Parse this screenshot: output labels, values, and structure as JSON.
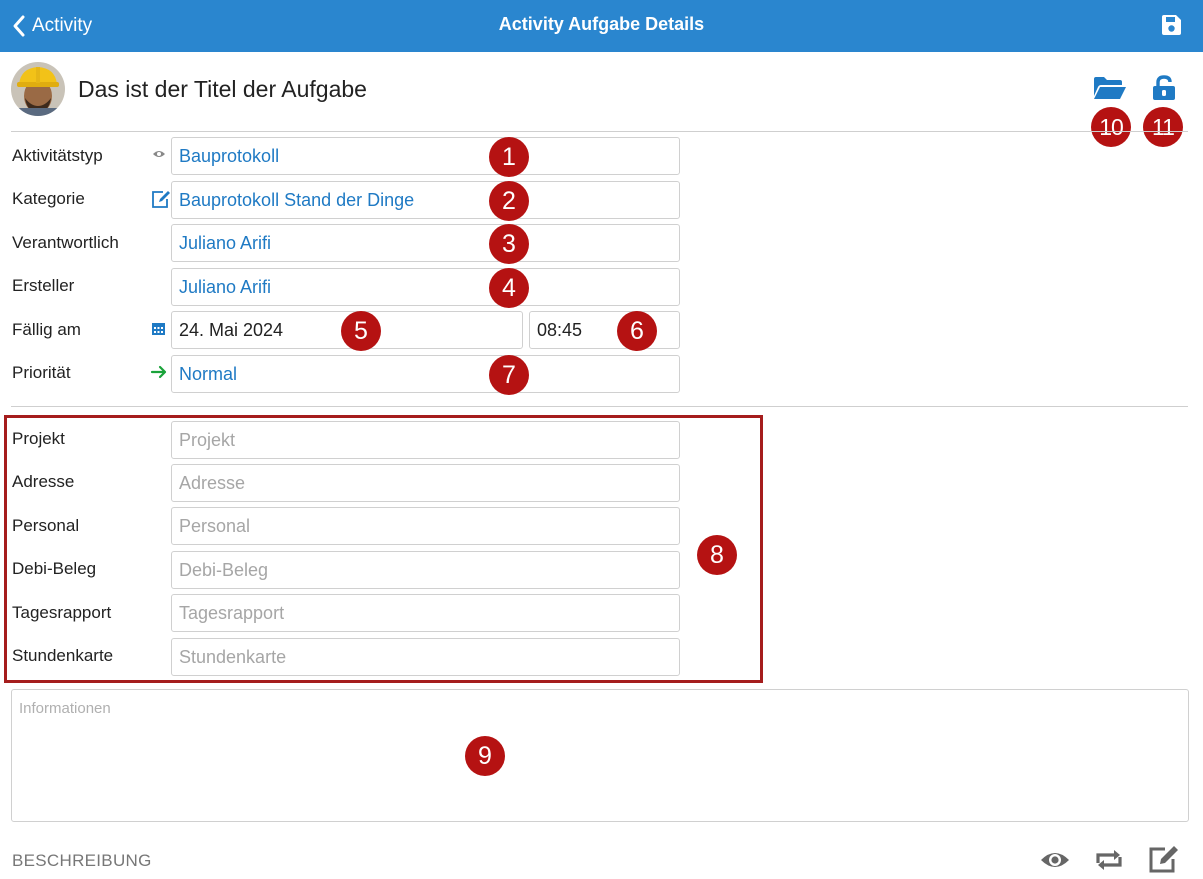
{
  "nav": {
    "back_label": "Activity",
    "title": "Activity Aufgabe Details"
  },
  "header": {
    "task_title": "Das ist der Titel der Aufgabe"
  },
  "form": {
    "aktivitaetstyp": {
      "label": "Aktivitätstyp",
      "value": "Bauprotokoll"
    },
    "kategorie": {
      "label": "Kategorie",
      "value": "Bauprotokoll Stand der Dinge"
    },
    "verantwortlich": {
      "label": "Verantwortlich",
      "value": "Juliano Arifi"
    },
    "ersteller": {
      "label": "Ersteller",
      "value": "Juliano Arifi"
    },
    "faellig": {
      "label": "Fällig am",
      "date": "24. Mai 2024",
      "time": "08:45"
    },
    "prioritaet": {
      "label": "Priorität",
      "value": "Normal"
    }
  },
  "links": {
    "projekt": {
      "label": "Projekt",
      "placeholder": "Projekt"
    },
    "adresse": {
      "label": "Adresse",
      "placeholder": "Adresse"
    },
    "personal": {
      "label": "Personal",
      "placeholder": "Personal"
    },
    "debi": {
      "label": "Debi-Beleg",
      "placeholder": "Debi-Beleg"
    },
    "tagesrapport": {
      "label": "Tagesrapport",
      "placeholder": "Tagesrapport"
    },
    "stundenkarte": {
      "label": "Stundenkarte",
      "placeholder": "Stundenkarte"
    }
  },
  "info": {
    "placeholder": "Informationen"
  },
  "section": {
    "label": "BESCHREIBUNG"
  },
  "badges": {
    "b1": "1",
    "b2": "2",
    "b3": "3",
    "b4": "4",
    "b5": "5",
    "b6": "6",
    "b7": "7",
    "b8": "8",
    "b9": "9",
    "b10": "10",
    "b11": "11"
  },
  "colors": {
    "nav_bar": "#2a86cf",
    "link_value": "#1f7ac4",
    "badge": "#b51212",
    "highlight_box": "#a51d1d",
    "priority_arrow": "#1aa33a"
  },
  "icons": [
    "chevron-left-icon",
    "save-icon",
    "folder-open-icon",
    "lock-open-icon",
    "eye-icon",
    "edit-icon",
    "calendar-icon",
    "arrow-right-icon",
    "repeat-icon"
  ]
}
